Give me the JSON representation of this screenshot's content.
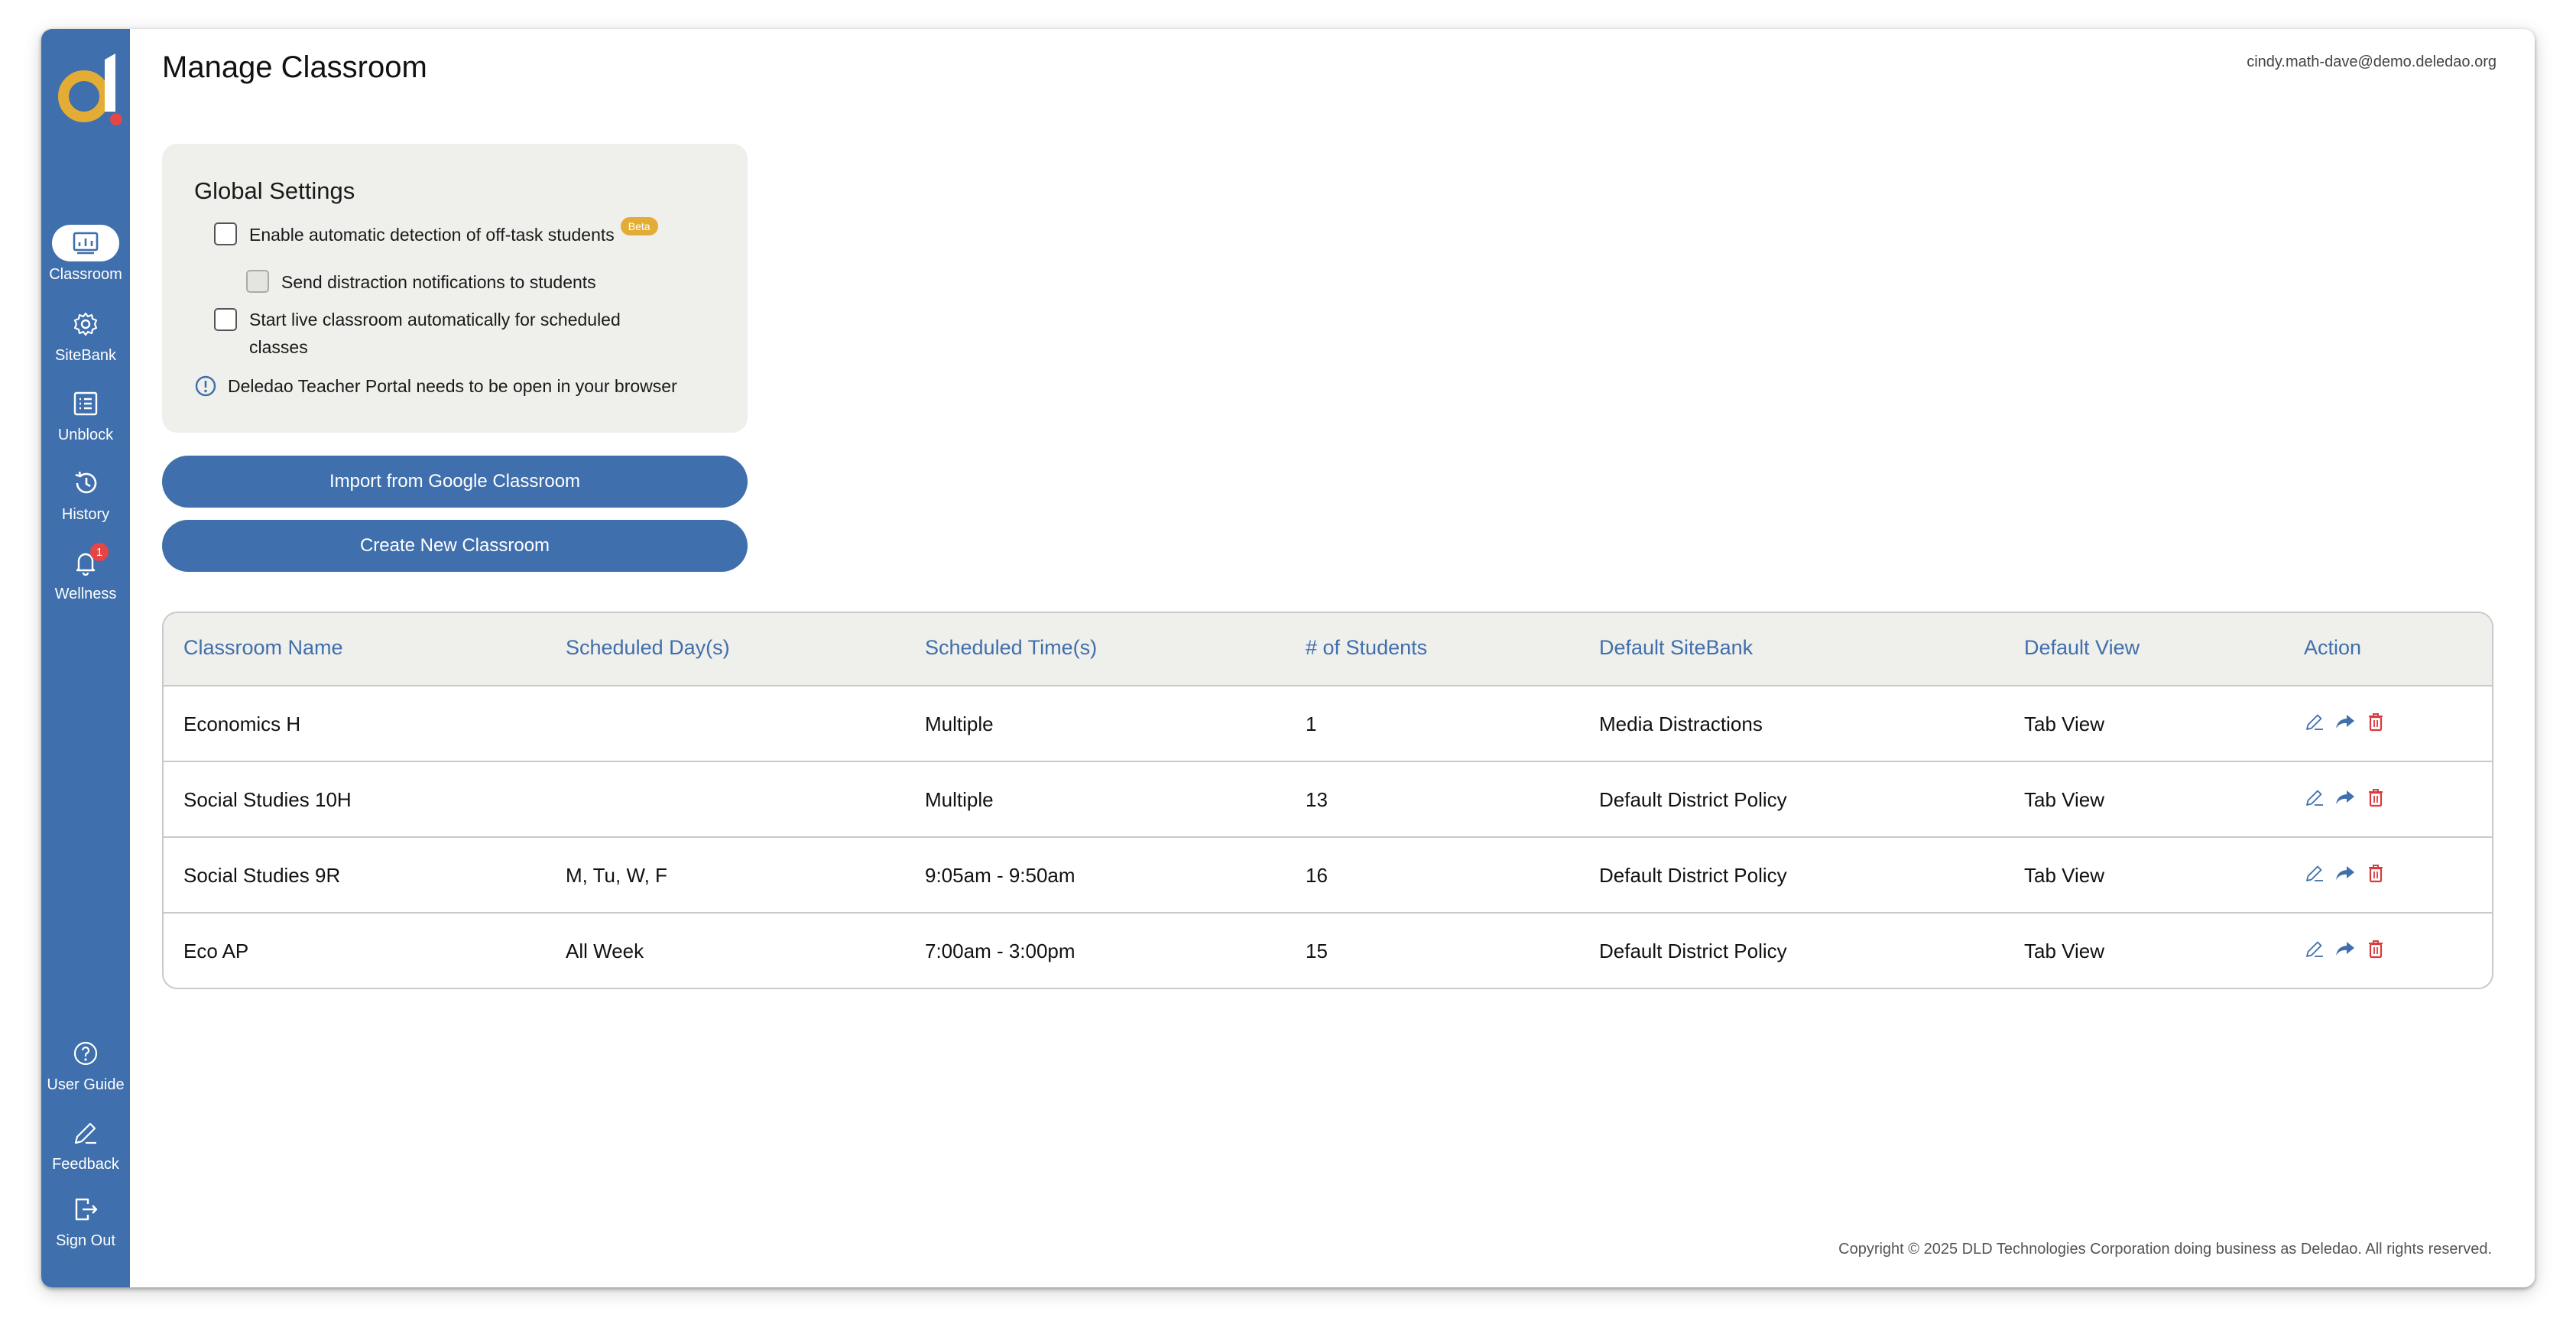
{
  "header": {
    "title": "Manage Classroom",
    "user_email": "cindy.math-dave@demo.deledao.org"
  },
  "sidebar": {
    "items": [
      {
        "label": "Classroom",
        "icon": "classroom-icon"
      },
      {
        "label": "SiteBank",
        "icon": "gear-icon"
      },
      {
        "label": "Unblock",
        "icon": "list-icon"
      },
      {
        "label": "History",
        "icon": "history-icon"
      },
      {
        "label": "Wellness",
        "icon": "bell-icon",
        "badge": "1"
      }
    ],
    "bottom_items": [
      {
        "label": "User Guide",
        "icon": "help-icon"
      },
      {
        "label": "Feedback",
        "icon": "pencil-icon"
      },
      {
        "label": "Sign Out",
        "icon": "sign-out-icon"
      }
    ]
  },
  "settings": {
    "title": "Global Settings",
    "option_detect": "Enable automatic detection of off-task students",
    "beta_label": "Beta",
    "option_notify": "Send distraction notifications to students",
    "option_live_line1": "Start live classroom automatically for scheduled",
    "option_live_line2": "classes",
    "info": "Deledao Teacher Portal needs to be open in your browser"
  },
  "buttons": {
    "import": "Import from Google Classroom",
    "create": "Create New Classroom"
  },
  "table": {
    "headers": [
      "Classroom Name",
      "Scheduled Day(s)",
      "Scheduled Time(s)",
      "# of Students",
      "Default SiteBank",
      "Default View",
      "Action"
    ],
    "rows": [
      [
        "Economics H",
        "",
        "Multiple",
        "1",
        "Media Distractions",
        "Tab View"
      ],
      [
        "Social Studies 10H",
        "",
        "Multiple",
        "13",
        "Default District Policy",
        "Tab View"
      ],
      [
        "Social Studies 9R",
        "M, Tu, W, F",
        "9:05am - 9:50am",
        "16",
        "Default District Policy",
        "Tab View"
      ],
      [
        "Eco AP",
        "All Week",
        "7:00am - 3:00pm",
        "15",
        "Default District Policy",
        "Tab View"
      ]
    ]
  },
  "footer": {
    "copyright": "Copyright © 2025 DLD Technologies Corporation doing business as Deledao. All rights reserved."
  },
  "colors": {
    "brand_blue": "#3f6fac",
    "logo_gold": "#e3ad35",
    "logo_red": "#e64545",
    "delete_red": "#d93b3b",
    "card_bg": "#efefeb"
  }
}
